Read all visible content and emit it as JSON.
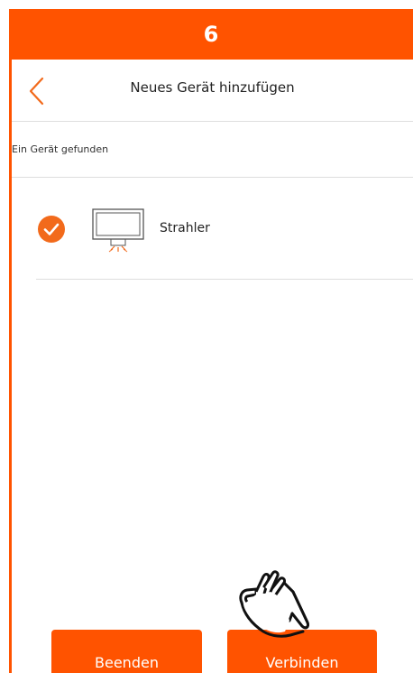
{
  "step": {
    "number": "6"
  },
  "header": {
    "title": "Neues Gerät hinzufügen"
  },
  "subheader": {
    "label": "Ein Gerät gefunden"
  },
  "devices": [
    {
      "name": "Strahler",
      "selected": true
    }
  ],
  "actions": {
    "quit_label": "Beenden",
    "connect_label": "Verbinden"
  },
  "colors": {
    "accent": "#ff5300",
    "check": "#f26a1b"
  },
  "icons": {
    "back": "chevron-left-icon",
    "check": "check-circle-icon",
    "device": "spotlight-icon",
    "pointer": "hand-pointer-icon"
  }
}
